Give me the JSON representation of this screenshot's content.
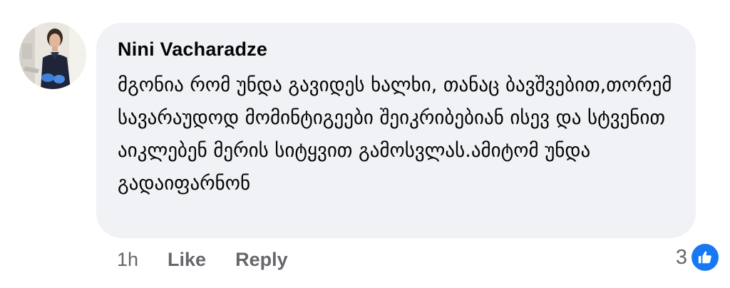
{
  "comment": {
    "author": "Nini Vacharadze",
    "text": "მგონია რომ უნდა გავიდეს ხალხი, თანაც ბავშვებით,თორემ სავარაუდოდ მომინტიგეები შეიკრიბებიან ისევ და სტვენით აიკლებენ მერის სიტყვით გამოსვლას.ამიტომ უნდა გადაიფარნონ",
    "avatar_icon": "profile-photo",
    "time": "1h",
    "like_label": "Like",
    "reply_label": "Reply",
    "reaction_count": "3",
    "reaction_icon": "thumbs-up-icon"
  },
  "colors": {
    "bubble": "#f0f2f5",
    "text": "#050505",
    "meta": "#65676b",
    "like_badge": "#1877f2"
  }
}
